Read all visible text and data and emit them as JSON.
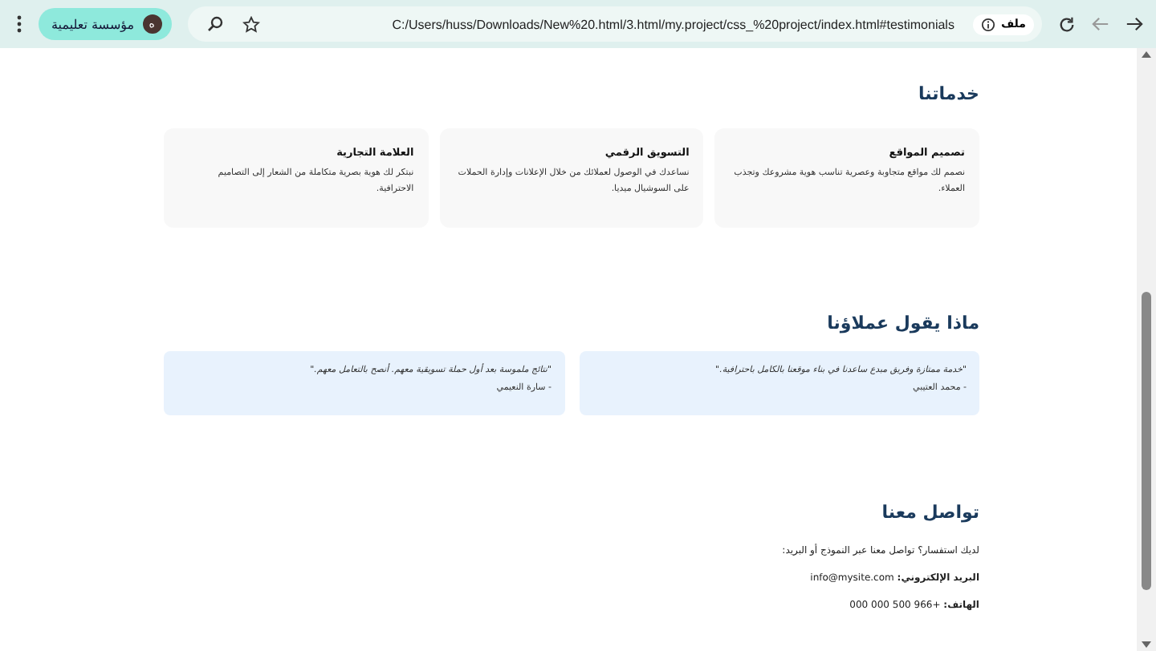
{
  "browser": {
    "url": "C:/Users/huss/Downloads/New%20.html/3.html/my.project/css_%20project/index.html#testimonials",
    "site_chip": "ملف",
    "profile": {
      "name": "مؤسسة تعليمية",
      "initial": "ه"
    }
  },
  "services": {
    "title": "خدماتنا",
    "items": [
      {
        "title": "تصميم المواقع",
        "text": "نصمم لك مواقع متجاوبة وعصرية تناسب هوية مشروعك وتجذب العملاء."
      },
      {
        "title": "التسويق الرقمي",
        "text": "نساعدك في الوصول لعملائك من خلال الإعلانات وإدارة الحملات على السوشيال ميديا."
      },
      {
        "title": "العلامة التجارية",
        "text": "نبتكر لك هوية بصرية متكاملة من الشعار إلى التصاميم الاحترافية."
      }
    ]
  },
  "testimonials": {
    "title": "ماذا يقول عملاؤنا",
    "items": [
      {
        "quote": "\"خدمة ممتازة وفريق مبدع ساعدنا في بناء موقعنا بالكامل باحترافية.\"",
        "author": "- محمد العتيبي"
      },
      {
        "quote": "\"نتائج ملموسة بعد أول حملة تسويقية معهم. أنصح بالتعامل معهم.\"",
        "author": "- سارة النعيمي"
      }
    ]
  },
  "contact": {
    "title": "تواصل معنا",
    "lines": [
      "لديك استفسار؟ تواصل معنا عبر النموذج أو البريد:",
      "**البريد الإلكتروني:** info@mysite.com",
      "**الهاتف:** +966 500 000 000"
    ]
  }
}
